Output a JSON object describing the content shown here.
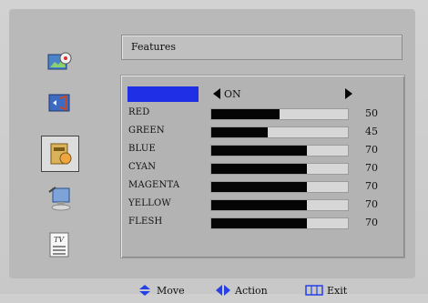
{
  "header": {
    "title": "Features"
  },
  "selected_row": {
    "label": "",
    "value": "ON"
  },
  "rows": [
    {
      "label": "RED",
      "fill": 0.5,
      "value": "50"
    },
    {
      "label": "GREEN",
      "fill": 0.41,
      "value": "45"
    },
    {
      "label": "BLUE",
      "fill": 0.7,
      "value": "70"
    },
    {
      "label": "CYAN",
      "fill": 0.7,
      "value": "70"
    },
    {
      "label": "MAGENTA",
      "fill": 0.7,
      "value": "70"
    },
    {
      "label": "YELLOW",
      "fill": 0.7,
      "value": "70"
    },
    {
      "label": "FLESH",
      "fill": 0.7,
      "value": "70"
    }
  ],
  "footer": {
    "move": "Move",
    "action": "Action",
    "exit": "Exit"
  },
  "colors": {
    "selection": "#1f2fe6",
    "bar_fill": "#050505"
  },
  "sidebar_icons": [
    "picture-icon",
    "sound-icon",
    "features-icon",
    "setup-icon",
    "tv-guide-icon"
  ]
}
